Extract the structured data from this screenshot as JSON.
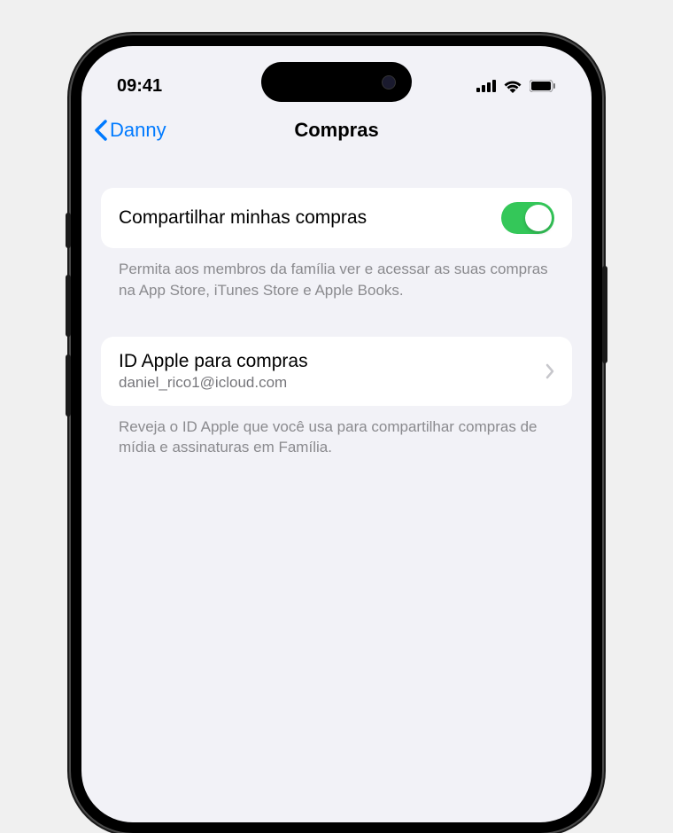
{
  "statusBar": {
    "time": "09:41"
  },
  "nav": {
    "backLabel": "Danny",
    "title": "Compras"
  },
  "sections": {
    "share": {
      "label": "Compartilhar minhas compras",
      "toggleOn": true,
      "footer": "Permita aos membros da família ver e acessar as suas compras na App Store, iTunes Store e Apple Books."
    },
    "appleId": {
      "label": "ID Apple para compras",
      "value": "daniel_rico1@icloud.com",
      "footer": "Reveja o ID Apple que você usa para compartilhar compras de mídia e assinaturas em Família."
    }
  },
  "colors": {
    "tint": "#007aff",
    "toggleOn": "#34c759",
    "background": "#f2f2f7"
  }
}
